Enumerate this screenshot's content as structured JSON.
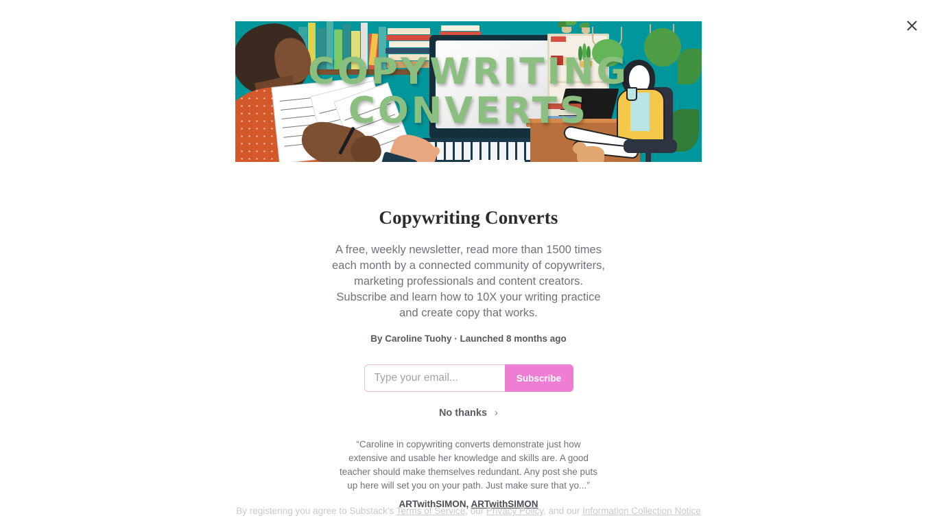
{
  "modal": {
    "close_label": "close-icon"
  },
  "hero": {
    "overlay_line1": "COPYWRITING",
    "overlay_line2": "CONVERTS",
    "overlay_color": "#8bbf7f",
    "background_color": "#00979c"
  },
  "publication": {
    "title": "Copywriting Converts",
    "description": "A free, weekly newsletter, read more than 1500 times each month by a connected community of copywriters, marketing professionals and content creators. Subscribe and learn how to 10X your writing practice and create copy that works.",
    "byline": "By Caroline Tuohy · Launched 8 months ago"
  },
  "form": {
    "email_placeholder": "Type your email...",
    "email_value": "",
    "subscribe_label": "Subscribe",
    "subscribe_color": "#ee7ed4",
    "no_thanks_label": "No thanks",
    "chevron": "›"
  },
  "testimonial": {
    "quote": "“Caroline in copywriting converts demonstrate just how extensive and usable her knowledge and skills are. A good teacher should make themselves redundant. Any post she puts up here will set you on your path. Just make sure that yo...”",
    "author_name": "ARTwithSIMON,",
    "author_link": "ARTwithSIMON"
  },
  "legal": {
    "prefix": "By registering you agree to Substack's ",
    "terms": "Terms of Service",
    "mid1": ", our ",
    "privacy": "Privacy Policy",
    "mid2": ", and our ",
    "notice": "Information Collection Notice"
  }
}
